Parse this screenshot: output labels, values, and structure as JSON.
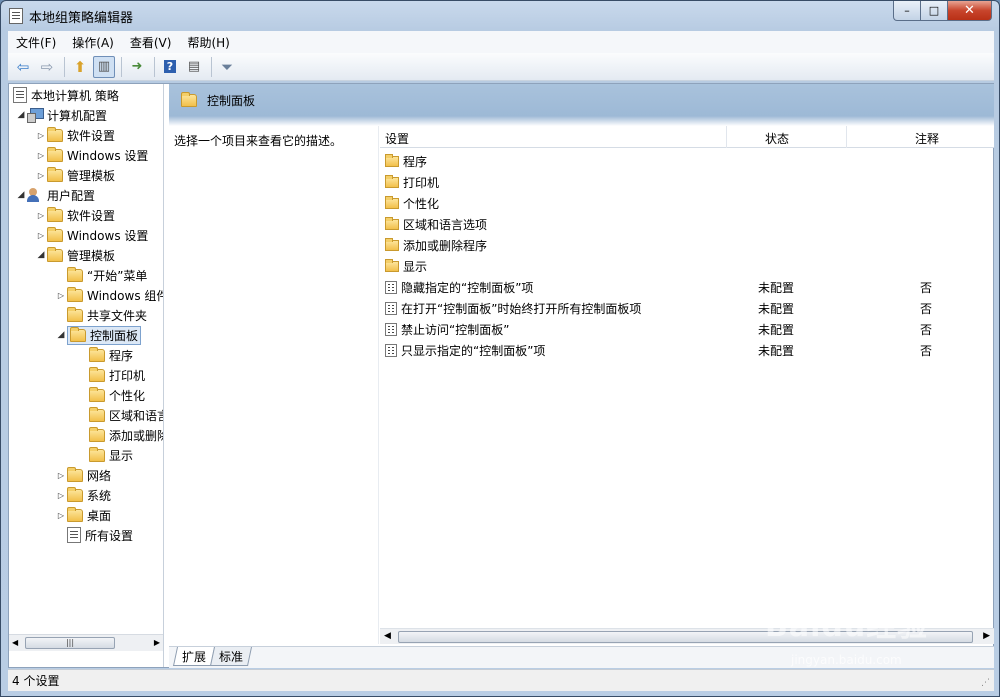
{
  "window": {
    "title": "本地组策略编辑器",
    "min": "–",
    "max": "□",
    "close": "✕"
  },
  "menu": [
    "文件(F)",
    "操作(A)",
    "查看(V)",
    "帮助(H)"
  ],
  "toolbar_icons": [
    "back-arrow-icon",
    "forward-arrow-icon",
    "up-folder-icon",
    "show-tree-icon",
    "export-list-icon",
    "help-icon",
    "view-icon",
    "filter-icon"
  ],
  "tree": {
    "root": "本地计算机 策略",
    "computer": "计算机配置",
    "computer_children": [
      "软件设置",
      "Windows 设置",
      "管理模板"
    ],
    "user": "用户配置",
    "user_children": [
      "软件设置",
      "Windows 设置",
      "管理模板"
    ],
    "admin_children": [
      "“开始”菜单",
      "Windows 组件",
      "共享文件夹",
      "控制面板"
    ],
    "cp_children": [
      "程序",
      "打印机",
      "个性化",
      "区域和语言",
      "添加或删除",
      "显示"
    ],
    "more_children": [
      "网络",
      "系统",
      "桌面",
      "所有设置"
    ]
  },
  "header": {
    "title": "控制面板"
  },
  "description": "选择一个项目来查看它的描述。",
  "columns": {
    "setting": "设置",
    "state": "状态",
    "comment": "注释"
  },
  "folders": [
    "程序",
    "打印机",
    "个性化",
    "区域和语言选项",
    "添加或删除程序",
    "显示"
  ],
  "settings": [
    {
      "name": "隐藏指定的“控制面板”项",
      "state": "未配置",
      "comment": "否"
    },
    {
      "name": "在打开“控制面板”时始终打开所有控制面板项",
      "state": "未配置",
      "comment": "否"
    },
    {
      "name": "禁止访问“控制面板”",
      "state": "未配置",
      "comment": "否"
    },
    {
      "name": "只显示指定的“控制面板”项",
      "state": "未配置",
      "comment": "否"
    }
  ],
  "tabs": [
    "扩展",
    "标准"
  ],
  "status": "4 个设置",
  "watermark": {
    "main": "Baidu经验",
    "sub": "jingyan.baidu.com"
  },
  "colors": {
    "header": "#9db9d6",
    "selection": "#dce8f6",
    "close": "#c8452c"
  }
}
